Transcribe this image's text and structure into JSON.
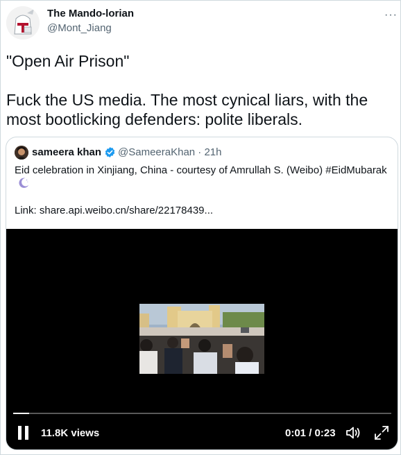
{
  "tweet": {
    "author_name": "The Mando-lorian",
    "author_handle": "@Mont_Jiang",
    "more_label": "···",
    "text": "\"Open Air Prison\"\n\nFuck the US media. The most cynical liars, with the most bootlicking defenders: polite liberals."
  },
  "quote": {
    "author_name": "sameera khan",
    "author_handle_time": "@SameeraKhan · 21h",
    "text": "Eid celebration in Xinjiang, China - courtesy of Amrullah S. (Weibo) #EidMubarak",
    "emoji_icon": "crescent-moon-icon",
    "link": "Link: share.api.weibo.cn/share/22178439..."
  },
  "video": {
    "views": "11.8K views",
    "time": "0:01 / 0:23",
    "progress": 0.043,
    "icons": [
      "pause-icon",
      "volume-icon",
      "fullscreen-icon"
    ]
  },
  "colors": {
    "text": "#0f1419",
    "secondary": "#536471",
    "border": "#cfd9de",
    "verified": "#1d9bf0",
    "video_bg": "#000000"
  }
}
